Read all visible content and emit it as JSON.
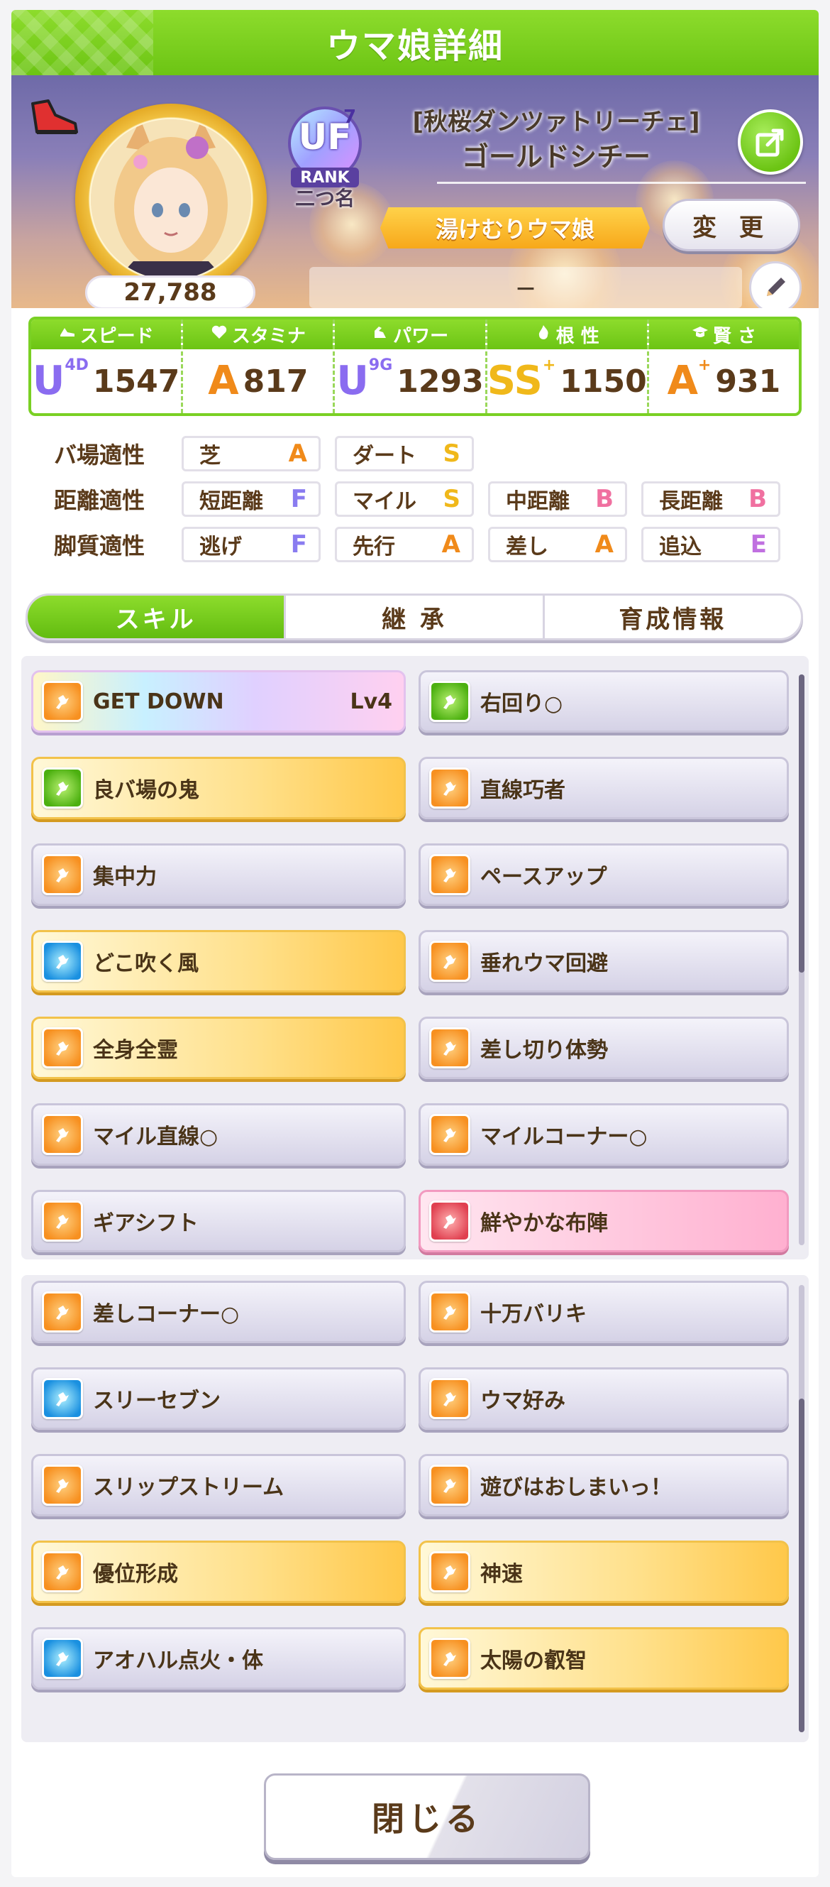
{
  "header": {
    "title": "ウマ娘詳細"
  },
  "character": {
    "title": "[秋桜ダンツァトリーチェ]",
    "name": "ゴールドシチー",
    "nickname": "湯けむりウマ娘",
    "fans": "27,788",
    "rank_sub": "二つ名",
    "rank_label": "RANK",
    "rank_grade": "UF",
    "rank_digit": "7",
    "comment": "－",
    "change_label": "変 更"
  },
  "stats": [
    {
      "label": "スピード",
      "icon": "shoe-icon",
      "grade": "U",
      "grade_sub": "4D",
      "value": "1547",
      "color": "#8a6cf0"
    },
    {
      "label": "スタミナ",
      "icon": "heart-icon",
      "grade": "A",
      "grade_sub": "",
      "value": "817",
      "color": "#f08a1a"
    },
    {
      "label": "パワー",
      "icon": "arm-icon",
      "grade": "U",
      "grade_sub": "9G",
      "value": "1293",
      "color": "#8a6cf0"
    },
    {
      "label": "根 性",
      "icon": "flame-icon",
      "grade": "SS",
      "grade_sub": "+",
      "value": "1150",
      "color": "#f0b81a"
    },
    {
      "label": "賢 さ",
      "icon": "graduation-cap-icon",
      "grade": "A",
      "grade_sub": "+",
      "value": "931",
      "color": "#f08a1a"
    }
  ],
  "aptitude": {
    "track": {
      "label": "バ場適性",
      "items": [
        {
          "name": "芝",
          "grade": "A"
        },
        {
          "name": "ダート",
          "grade": "S"
        }
      ]
    },
    "distance": {
      "label": "距離適性",
      "items": [
        {
          "name": "短距離",
          "grade": "F"
        },
        {
          "name": "マイル",
          "grade": "S"
        },
        {
          "name": "中距離",
          "grade": "B"
        },
        {
          "name": "長距離",
          "grade": "B"
        }
      ]
    },
    "style": {
      "label": "脚質適性",
      "items": [
        {
          "name": "逃げ",
          "grade": "F"
        },
        {
          "name": "先行",
          "grade": "A"
        },
        {
          "name": "差し",
          "grade": "A"
        },
        {
          "name": "追込",
          "grade": "E"
        }
      ]
    }
  },
  "grade_colors": {
    "A": "#f08a1a",
    "S": "#f0b81a",
    "B": "#f070a0",
    "F": "#8a7cf0",
    "E": "#c070e0"
  },
  "tabs": [
    {
      "label": "スキル",
      "active": true
    },
    {
      "label": "継 承",
      "active": false
    },
    {
      "label": "育成情報",
      "active": false
    }
  ],
  "skills_panel_1": [
    {
      "name": "GET DOWN",
      "lv": "Lv4",
      "style": "rainbow",
      "icon": "ic-orange"
    },
    {
      "name": "右回り○",
      "lv": "",
      "style": "",
      "icon": "ic-green"
    },
    {
      "name": "良バ場の鬼",
      "lv": "",
      "style": "gold",
      "icon": "ic-green"
    },
    {
      "name": "直線巧者",
      "lv": "",
      "style": "",
      "icon": "ic-orange"
    },
    {
      "name": "集中力",
      "lv": "",
      "style": "",
      "icon": "ic-orange"
    },
    {
      "name": "ペースアップ",
      "lv": "",
      "style": "",
      "icon": "ic-orange"
    },
    {
      "name": "どこ吹く風",
      "lv": "",
      "style": "gold",
      "icon": "ic-blue"
    },
    {
      "name": "垂れウマ回避",
      "lv": "",
      "style": "",
      "icon": "ic-orange"
    },
    {
      "name": "全身全霊",
      "lv": "",
      "style": "gold",
      "icon": "ic-orange"
    },
    {
      "name": "差し切り体勢",
      "lv": "",
      "style": "",
      "icon": "ic-orange"
    },
    {
      "name": "マイル直線○",
      "lv": "",
      "style": "",
      "icon": "ic-orange"
    },
    {
      "name": "マイルコーナー○",
      "lv": "",
      "style": "",
      "icon": "ic-orange"
    },
    {
      "name": "ギアシフト",
      "lv": "",
      "style": "",
      "icon": "ic-orange"
    },
    {
      "name": "鮮やかな布陣",
      "lv": "",
      "style": "pink",
      "icon": "ic-red"
    }
  ],
  "skills_panel_2": [
    {
      "name": "差しコーナー○",
      "lv": "",
      "style": "",
      "icon": "ic-orange"
    },
    {
      "name": "十万バリキ",
      "lv": "",
      "style": "",
      "icon": "ic-orange"
    },
    {
      "name": "スリーセブン",
      "lv": "",
      "style": "",
      "icon": "ic-blue"
    },
    {
      "name": "ウマ好み",
      "lv": "",
      "style": "",
      "icon": "ic-orange"
    },
    {
      "name": "スリップストリーム",
      "lv": "",
      "style": "",
      "icon": "ic-orange"
    },
    {
      "name": "遊びはおしまいっ！",
      "lv": "",
      "style": "",
      "icon": "ic-orange"
    },
    {
      "name": "優位形成",
      "lv": "",
      "style": "gold",
      "icon": "ic-orange"
    },
    {
      "name": "神速",
      "lv": "",
      "style": "gold",
      "icon": "ic-orange"
    },
    {
      "name": "アオハル点火・体",
      "lv": "",
      "style": "",
      "icon": "ic-blue"
    },
    {
      "name": "太陽の叡智",
      "lv": "",
      "style": "gold",
      "icon": "ic-orange"
    }
  ],
  "close_label": "閉じる"
}
